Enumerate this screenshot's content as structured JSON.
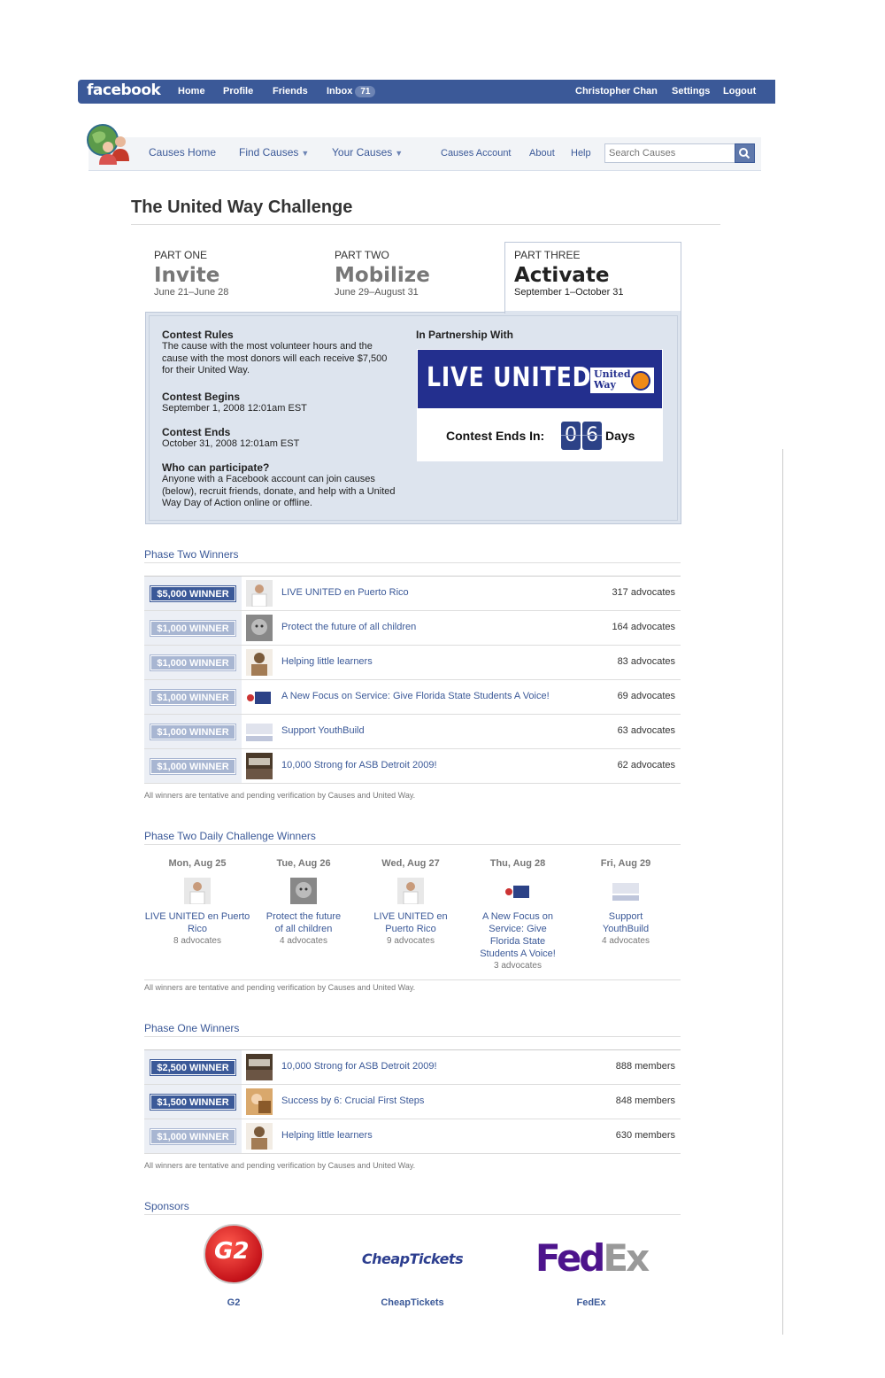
{
  "fb": {
    "logo": "facebook",
    "nav": [
      "Home",
      "Profile",
      "Friends",
      "Inbox"
    ],
    "inbox_count": "71",
    "user": "Christopher Chan",
    "settings": "Settings",
    "logout": "Logout"
  },
  "causes": {
    "home": "Causes Home",
    "find": "Find Causes",
    "yours": "Your Causes",
    "account": "Causes Account",
    "about": "About",
    "help": "Help",
    "search_placeholder": "Search Causes"
  },
  "title": "The United Way Challenge",
  "parts": [
    {
      "label": "PART ONE",
      "name": "Invite",
      "dates": "June 21–June 28"
    },
    {
      "label": "PART TWO",
      "name": "Mobilize",
      "dates": "June 29–August 31"
    },
    {
      "label": "PART THREE",
      "name": "Activate",
      "dates": "September 1–October 31"
    }
  ],
  "rules": {
    "rules_h": "Contest Rules",
    "rules_t": "The cause with the most volunteer hours and the cause with the most donors will each receive $7,500 for their United Way.",
    "begins_h": "Contest Begins",
    "begins_t": "September 1, 2008 12:01am EST",
    "ends_h": "Contest Ends",
    "ends_t": "October 31, 2008 12:01am EST",
    "who_h": "Who can participate?",
    "who_t": "Anyone with a Facebook account can join causes (below), recruit friends, donate, and help with a United Way Day of Action online or offline."
  },
  "partner": {
    "heading": "In Partnership With",
    "banner": "LIVE UNITED",
    "uw_logo": "United Way",
    "ends_label": "Contest Ends In:",
    "digits": [
      "0",
      "6"
    ],
    "days": "Days"
  },
  "phase_two": {
    "heading": "Phase Two Winners",
    "rows": [
      {
        "badge": "$5,000 WINNER",
        "name": "LIVE UNITED en Puerto Rico",
        "count": "317 advocates"
      },
      {
        "badge": "$1,000 WINNER",
        "name": "Protect the future of all children",
        "count": "164 advocates"
      },
      {
        "badge": "$1,000 WINNER",
        "name": "Helping little learners",
        "count": "83 advocates"
      },
      {
        "badge": "$1,000 WINNER",
        "name": "A New Focus on Service: Give Florida State Students A Voice!",
        "count": "69 advocates"
      },
      {
        "badge": "$1,000 WINNER",
        "name": "Support YouthBuild",
        "count": "63 advocates"
      },
      {
        "badge": "$1,000 WINNER",
        "name": "10,000 Strong for ASB Detroit 2009!",
        "count": "62 advocates"
      }
    ],
    "note": "All winners are tentative and pending verification by Causes and United Way."
  },
  "daily": {
    "heading": "Phase Two Daily Challenge Winners",
    "days": [
      {
        "day": "Mon, Aug 25",
        "name": "LIVE UNITED en Puerto Rico",
        "count": "8 advocates"
      },
      {
        "day": "Tue, Aug 26",
        "name": "Protect the future of all children",
        "count": "4 advocates"
      },
      {
        "day": "Wed, Aug 27",
        "name": "LIVE UNITED en Puerto Rico",
        "count": "9 advocates"
      },
      {
        "day": "Thu, Aug 28",
        "name": "A New Focus on Service: Give Florida State Students A Voice!",
        "count": "3 advocates"
      },
      {
        "day": "Fri, Aug 29",
        "name": "Support YouthBuild",
        "count": "4 advocates"
      }
    ],
    "note": "All winners are tentative and pending verification by Causes and United Way."
  },
  "phase_one": {
    "heading": "Phase One Winners",
    "rows": [
      {
        "badge": "$2,500 WINNER",
        "name": "10,000 Strong for ASB Detroit 2009!",
        "count": "888 members"
      },
      {
        "badge": "$1,500 WINNER",
        "name": "Success by 6: Crucial First Steps",
        "count": "848 members"
      },
      {
        "badge": "$1,000 WINNER",
        "name": "Helping little learners",
        "count": "630 members"
      }
    ],
    "note": "All winners are tentative and pending verification by Causes and United Way."
  },
  "sponsors": {
    "heading": "Sponsors",
    "items": [
      {
        "logo": "G2",
        "label": "G2"
      },
      {
        "logo": "CheapTickets",
        "label": "CheapTickets"
      },
      {
        "logo_fe": "Fed",
        "logo_ex": "Ex",
        "label": "FedEx"
      }
    ]
  }
}
